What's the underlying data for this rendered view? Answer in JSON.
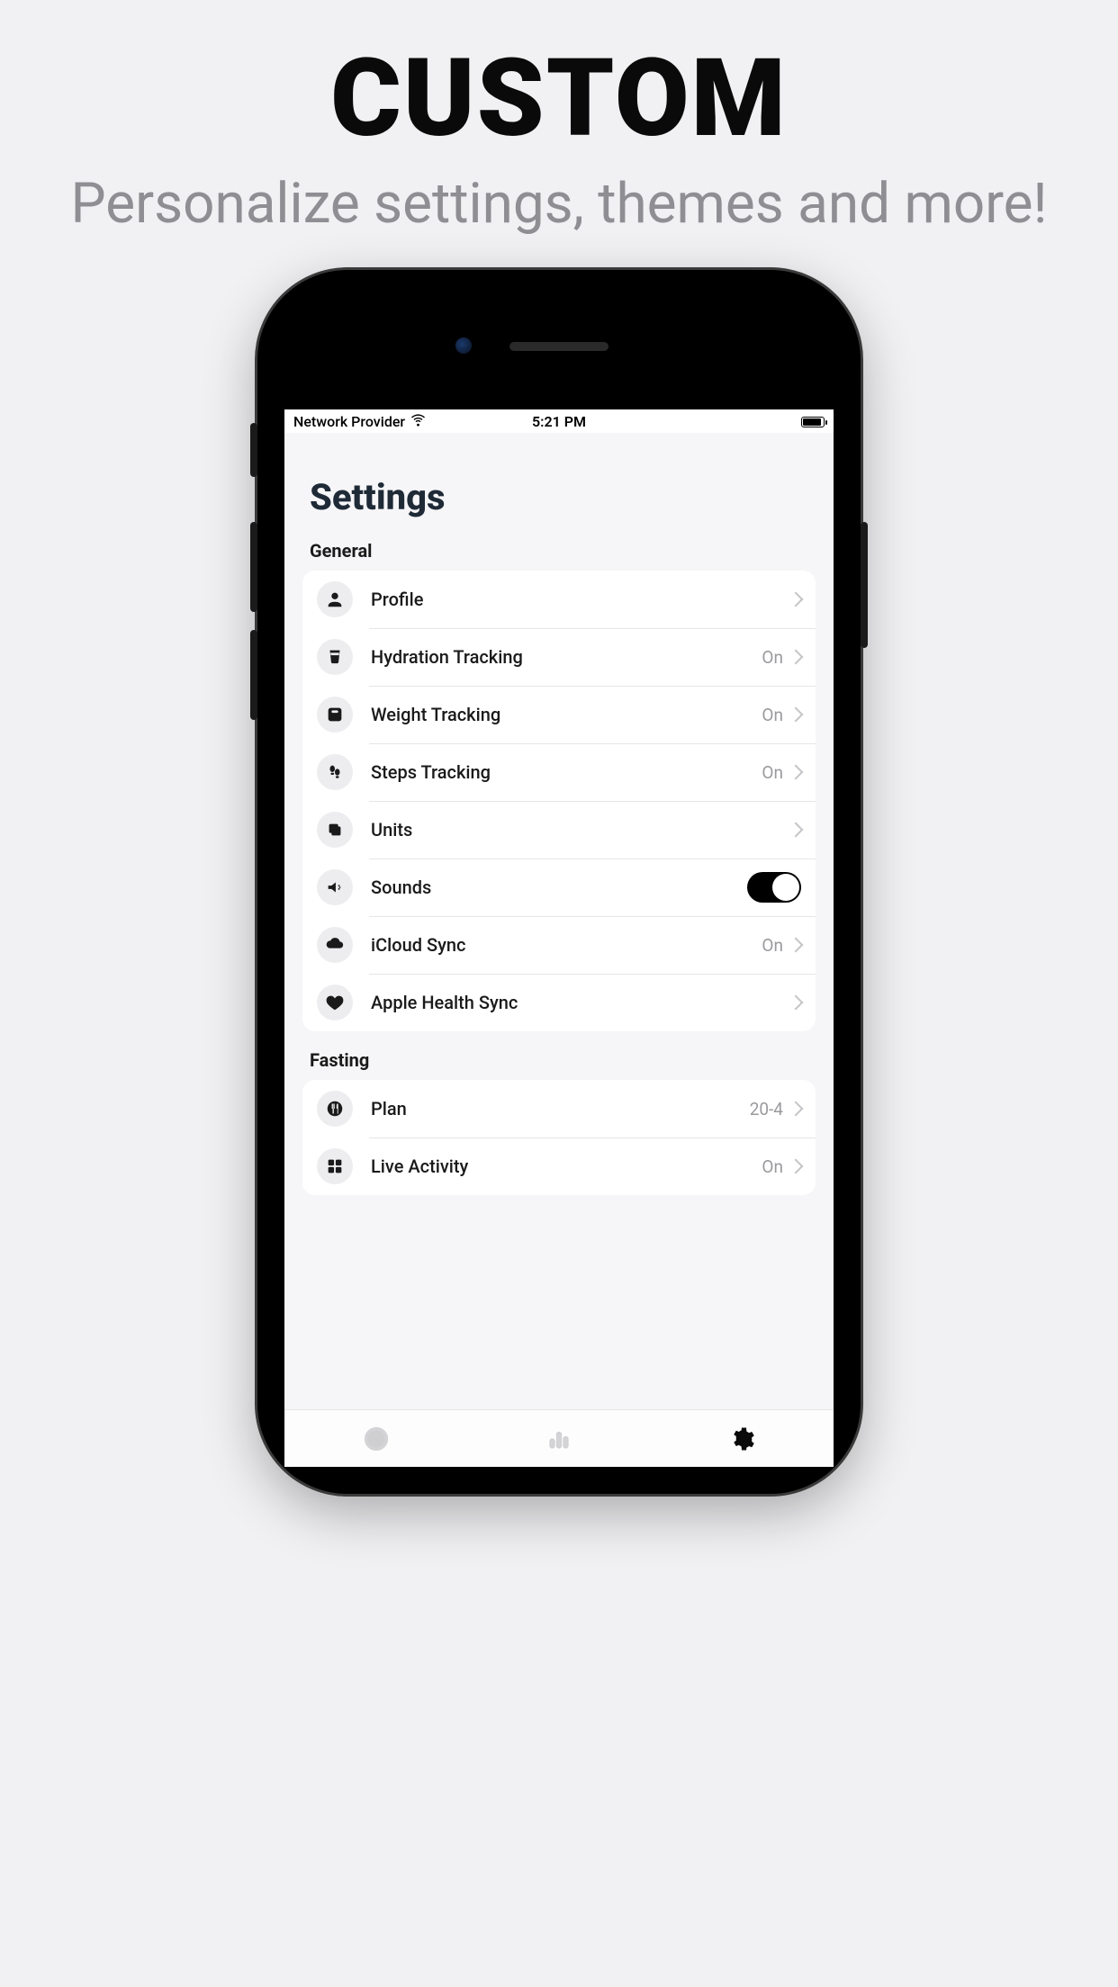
{
  "marketing": {
    "headline": "CUSTOM",
    "subhead": "Personalize settings, themes and more!"
  },
  "statusbar": {
    "carrier": "Network Provider",
    "time": "5:21 PM"
  },
  "page": {
    "title": "Settings"
  },
  "sections": {
    "general": {
      "header": "General",
      "rows": {
        "profile": {
          "label": "Profile"
        },
        "hydration": {
          "label": "Hydration Tracking",
          "value": "On"
        },
        "weight": {
          "label": "Weight Tracking",
          "value": "On"
        },
        "steps": {
          "label": "Steps Tracking",
          "value": "On"
        },
        "units": {
          "label": "Units"
        },
        "sounds": {
          "label": "Sounds",
          "toggle": true
        },
        "icloud": {
          "label": "iCloud Sync",
          "value": "On"
        },
        "health": {
          "label": "Apple Health Sync"
        }
      }
    },
    "fasting": {
      "header": "Fasting",
      "rows": {
        "plan": {
          "label": "Plan",
          "value": "20-4"
        },
        "live": {
          "label": "Live Activity",
          "value": "On"
        }
      }
    }
  }
}
